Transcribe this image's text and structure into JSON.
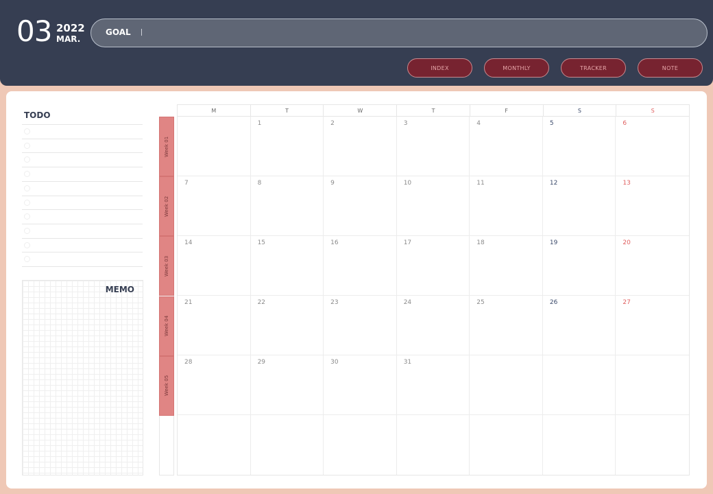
{
  "header": {
    "month_number": "03",
    "year": "2022",
    "month_abbr": "MAR.",
    "goal_label": "GOAL",
    "goal_value": ""
  },
  "nav": {
    "buttons": [
      {
        "label": "INDEX"
      },
      {
        "label": "MONTHLY"
      },
      {
        "label": "TRACKER"
      },
      {
        "label": "NOTE"
      }
    ]
  },
  "todo": {
    "title": "TODO",
    "item_count": 10
  },
  "memo": {
    "title": "MEMO"
  },
  "weeks": [
    "Week 01",
    "Week 02",
    "Week 03",
    "Week 04",
    "Week 05"
  ],
  "calendar": {
    "weekdays": [
      {
        "label": "M",
        "color": "#666666"
      },
      {
        "label": "T",
        "color": "#666666"
      },
      {
        "label": "W",
        "color": "#666666"
      },
      {
        "label": "T",
        "color": "#666666"
      },
      {
        "label": "F",
        "color": "#666666"
      },
      {
        "label": "S",
        "color": "#3b4a6b"
      },
      {
        "label": "S",
        "color": "#e06060"
      }
    ],
    "rows": [
      [
        "",
        "1",
        "2",
        "3",
        "4",
        "5",
        "6"
      ],
      [
        "7",
        "8",
        "9",
        "10",
        "11",
        "12",
        "13"
      ],
      [
        "14",
        "15",
        "16",
        "17",
        "18",
        "19",
        "20"
      ],
      [
        "21",
        "22",
        "23",
        "24",
        "25",
        "26",
        "27"
      ],
      [
        "28",
        "29",
        "30",
        "31",
        "",
        "",
        ""
      ],
      [
        "",
        "",
        "",
        "",
        "",
        "",
        ""
      ]
    ]
  },
  "colors": {
    "header_bg": "#363e52",
    "page_bg": "#efc8b6",
    "button_bg": "#772330",
    "button_text": "#e7a6a9",
    "week_tab": "#e08584",
    "saturday": "#3b4a6b",
    "sunday": "#e06060",
    "weekday_date": "#8a8a8a"
  }
}
